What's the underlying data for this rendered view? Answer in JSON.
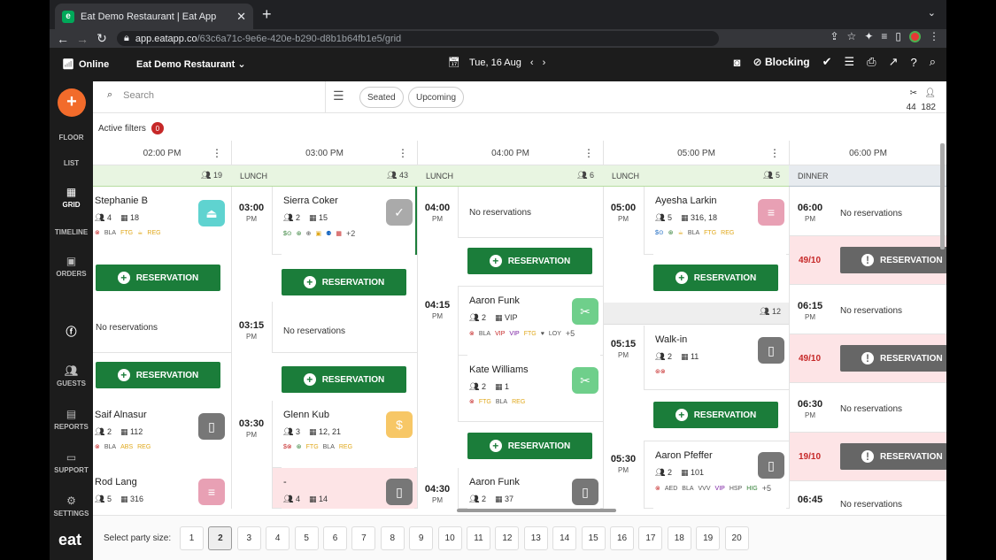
{
  "browser": {
    "tab_title": "Eat Demo Restaurant | Eat App",
    "url_host": "app.eatapp.co",
    "url_path": "/63c6a71c-9e6e-420e-b290-d8b1b64fb1e5/grid"
  },
  "header": {
    "status": "Online",
    "restaurant": "Eat Demo Restaurant",
    "date": "Tue, 16 Aug",
    "blocking": "Blocking"
  },
  "sidebar": {
    "items": [
      {
        "label": "FLOOR"
      },
      {
        "label": "LIST"
      },
      {
        "label": "GRID"
      },
      {
        "label": "TIMELINE"
      },
      {
        "label": "ORDERS"
      },
      {
        "label": "GUESTS"
      },
      {
        "label": "REPORTS"
      },
      {
        "label": "SUPPORT"
      },
      {
        "label": "SETTINGS"
      }
    ],
    "logo": "eat"
  },
  "toolbar": {
    "search_placeholder": "Search",
    "seated": "Seated",
    "upcoming": "Upcoming",
    "covers_top": "44",
    "covers_bottom": "182",
    "active_filters": "Active filters",
    "filters_count": "0"
  },
  "hours": [
    "02:00 PM",
    "03:00 PM",
    "04:00 PM",
    "05:00 PM",
    "06:00 PM"
  ],
  "shifts": [
    {
      "label": "",
      "count": "19"
    },
    {
      "label": "LUNCH",
      "count": "43"
    },
    {
      "label": "LUNCH",
      "count": "6"
    },
    {
      "label": "LUNCH",
      "count": "5"
    },
    {
      "label": "DINNER",
      "count": ""
    }
  ],
  "col0": {
    "c1": {
      "name": "Stephanie B",
      "party": "4",
      "table": "18",
      "tags": [
        "BLA",
        "FTG",
        "REG"
      ]
    },
    "no_res": "No reservations",
    "c2": {
      "name": "Saif Alnasur",
      "party": "2",
      "table": "112",
      "tags": [
        "BLA",
        "ABS",
        "REG"
      ]
    },
    "c3": {
      "name": "Rod Lang",
      "party": "5",
      "table": "316"
    }
  },
  "col1": {
    "t1": "03:00",
    "t1p": "PM",
    "c1": {
      "name": "Sierra Coker",
      "party": "2",
      "table": "15",
      "more": "+2"
    },
    "t2": "03:15",
    "t2p": "PM",
    "no_res": "No reservations",
    "t3": "03:30",
    "t3p": "PM",
    "c2": {
      "name": "Glenn Kub",
      "party": "3",
      "table": "12, 21",
      "tags": [
        "FTG",
        "BLA",
        "REG"
      ]
    },
    "c3": {
      "name": "-",
      "party": "4",
      "table": "14"
    }
  },
  "col2": {
    "t1": "04:00",
    "t1p": "PM",
    "no_res": "No reservations",
    "t2": "04:15",
    "t2p": "PM",
    "c1": {
      "name": "Aaron Funk",
      "party": "2",
      "table": "VIP",
      "tags": [
        "BLA",
        "VIP",
        "VIP",
        "FTG",
        "LOY"
      ],
      "more": "+5"
    },
    "c2": {
      "name": "Kate Williams",
      "party": "2",
      "table": "1",
      "tags": [
        "FTG",
        "BLA",
        "REG"
      ]
    },
    "t3": "04:30",
    "t3p": "PM",
    "c3": {
      "name": "Aaron Funk",
      "party": "2",
      "table": "37"
    }
  },
  "col3": {
    "t1": "05:00",
    "t1p": "PM",
    "c1": {
      "name": "Ayesha Larkin",
      "party": "5",
      "table": "316, 18",
      "tags": [
        "BLA",
        "FTG",
        "REG"
      ]
    },
    "count2": "12",
    "t2": "05:15",
    "t2p": "PM",
    "c2": {
      "name": "Walk-in",
      "party": "2",
      "table": "11"
    },
    "t3": "05:30",
    "t3p": "PM",
    "c3": {
      "name": "Aaron Pfeffer",
      "party": "2",
      "table": "101",
      "tags": [
        "AED",
        "BLA",
        "VVV",
        "VIP",
        "HSP",
        "HIG"
      ],
      "more": "+5"
    }
  },
  "col4": {
    "rows": [
      {
        "time": "06:00",
        "pm": "PM",
        "text": "No reservations"
      },
      {
        "ratio": "49/10"
      },
      {
        "time": "06:15",
        "pm": "PM",
        "text": "No reservations"
      },
      {
        "ratio": "49/10"
      },
      {
        "time": "06:30",
        "pm": "PM",
        "text": "No reservations"
      },
      {
        "ratio": "19/10"
      },
      {
        "time": "06:45",
        "pm": "",
        "text": "No reservations"
      }
    ]
  },
  "reservation_label": "RESERVATION",
  "footer": {
    "label": "Select party size:",
    "sizes": [
      "1",
      "2",
      "3",
      "4",
      "5",
      "6",
      "7",
      "8",
      "9",
      "10",
      "11",
      "12",
      "13",
      "14",
      "15",
      "16",
      "17",
      "18",
      "19",
      "20"
    ],
    "selected": "2"
  },
  "colors": {
    "green": "#1b7d3a",
    "orange": "#f26b2b",
    "teal": "#5fd3d0",
    "pink": "#e8a0b4",
    "grey": "#777777",
    "gold": "#f7c766"
  },
  "icons": {
    "status_seated": "chair-icon",
    "status_reserved": "phone-icon",
    "status_dining": "utensils-icon",
    "status_paid": "dollar-icon",
    "status_check": "check-icon",
    "status_bill": "receipt-icon"
  }
}
